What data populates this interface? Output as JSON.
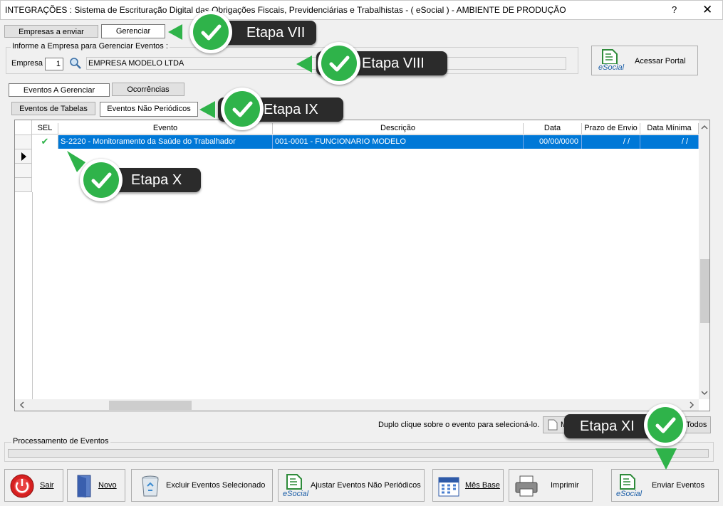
{
  "window": {
    "title": "INTEGRAÇÕES : Sistema de Escrituração Digital das Obrigações Fiscais, Previdenciárias e Trabalhistas - ( eSocial ) - AMBIENTE DE PRODUÇÃO",
    "help": "?",
    "close": "✕"
  },
  "top_tabs": [
    "Empresas a enviar",
    "Gerenciar"
  ],
  "empresa_group": {
    "legend": "Informe a Empresa para Gerenciar Eventos :",
    "label": "Empresa",
    "code": "1",
    "name": "EMPRESA MODELO LTDA"
  },
  "portal_button": "Acessar Portal",
  "esocial_logo": "eSocial",
  "sub_tabs": [
    "Eventos A Gerenciar",
    "Ocorrências"
  ],
  "event_tabs": [
    "Eventos de Tabelas",
    "Eventos Não Periódicos"
  ],
  "grid": {
    "columns": [
      "SEL",
      "Evento",
      "Descrição",
      "Data",
      "Prazo de Envio",
      "Data Mínima"
    ],
    "rows": [
      {
        "sel": "✔",
        "evento": "S-2220 - Monitoramento da Saúde do Trabalhador",
        "descricao": "001-0001 - FUNCIONARIO MODELO",
        "data": "00/00/0000",
        "prazo": "/ /",
        "minima": "/ /"
      }
    ]
  },
  "hint": "Duplo clique sobre o evento para selecioná-lo.",
  "mark_button_partial": "Ma",
  "mark_all_partial": "Todos",
  "processing": {
    "legend": "Processamento de Eventos",
    "progress": 0
  },
  "bottom": {
    "sair": "Sair",
    "novo": "Novo",
    "excluir": "Excluir Eventos Selecionado",
    "ajustar": "Ajustar Eventos Não Periódicos",
    "mes_base": "Mês Base",
    "imprimir": "Imprimir",
    "enviar": "Enviar Eventos"
  },
  "callouts": [
    "Etapa VII",
    "Etapa VIII",
    "Etapa IX",
    "Etapa X",
    "Etapa XI"
  ],
  "colors": {
    "selection": "#0078d7",
    "badge": "#2fb34a",
    "callout": "#2b2b2b"
  }
}
